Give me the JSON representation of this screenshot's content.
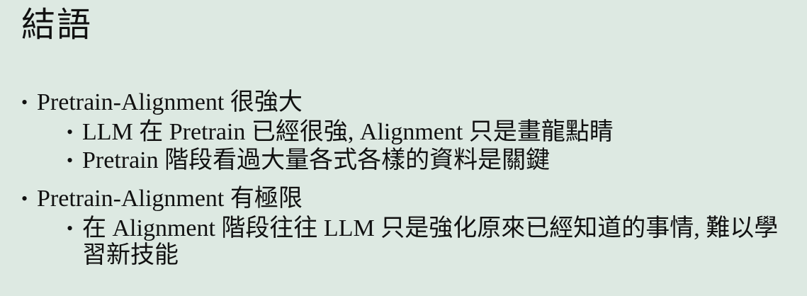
{
  "slide": {
    "title": "結語",
    "bullet_symbol": "•",
    "items": [
      {
        "text": "Pretrain-Alignment 很強大",
        "sub": [
          {
            "text": "LLM 在 Pretrain 已經很強, Alignment 只是畫龍點睛"
          },
          {
            "text": "Pretrain 階段看過大量各式各樣的資料是關鍵"
          }
        ]
      },
      {
        "text": "Pretrain-Alignment 有極限",
        "sub": [
          {
            "text": "在 Alignment 階段往往 LLM 只是強化原來已經知道的事情, 難以學習新技能"
          }
        ]
      }
    ]
  }
}
